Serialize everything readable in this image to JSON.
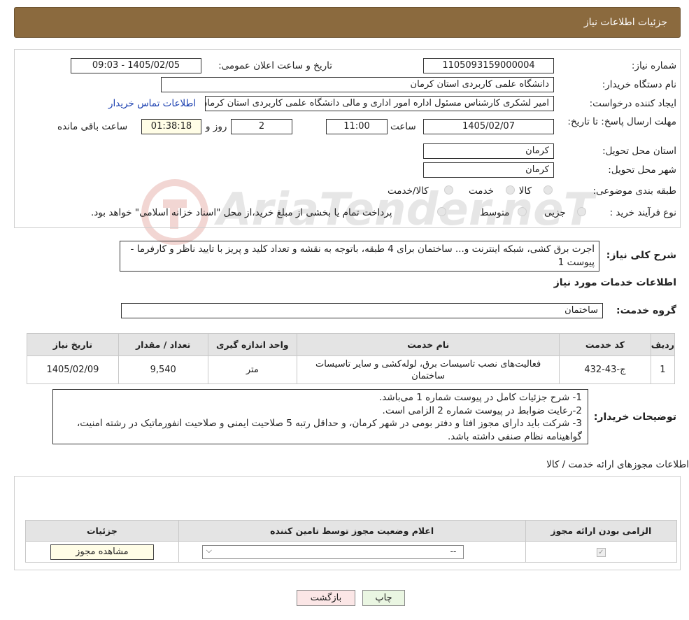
{
  "header": {
    "title": "جزئیات اطلاعات نیاز"
  },
  "form": {
    "need_number_label": "شماره نیاز:",
    "need_number": "1105093159000004",
    "announce_label": "تاریخ و ساعت اعلان عمومی:",
    "announce_value": "1405/02/05 - 09:03",
    "buyer_org_label": "نام دستگاه خریدار:",
    "buyer_org": "دانشگاه علمی کاربردی استان کرمان",
    "creator_label": "ایجاد کننده درخواست:",
    "creator": "امیر لشکری کارشناس مسئول اداره امور اداری و مالی دانشگاه علمی کاربردی استان کرمان",
    "contact_link": "اطلاعات تماس خریدار",
    "deadline_label": "مهلت ارسال پاسخ: تا تاریخ:",
    "deadline_date": "1405/02/07",
    "time_label": "ساعت",
    "deadline_time": "11:00",
    "days": "2",
    "days_label": "روز و",
    "remaining": "01:38:18",
    "remaining_label": "ساعت باقی مانده",
    "province_label": "استان محل تحویل:",
    "province": "کرمان",
    "city_label": "شهر محل تحویل:",
    "city": "کرمان",
    "category_label": "طبقه بندی موضوعی:",
    "category_options": [
      "کالا",
      "خدمت",
      "کالا/خدمت"
    ],
    "process_label": "نوع فرآیند خرید :",
    "process_options": [
      "جزیی",
      "متوسط"
    ],
    "process_note": "پرداخت تمام یا بخشی از مبلغ خرید،از محل \"اسناد خزانه اسلامی\" خواهد بود."
  },
  "summary": {
    "label": "شرح کلی نیاز:",
    "text": "اجرت برق کشی، شبکه اینترنت و... ساختمان برای 4 طبقه، باتوجه به نقشه و تعداد کلید و پریز با تایید ناظر و کارفرما - پیوست 1"
  },
  "services": {
    "section_title": "اطلاعات خدمات مورد نیاز",
    "group_label": "گروه خدمت:",
    "group_value": "ساختمان",
    "headers": [
      "ردیف",
      "کد خدمت",
      "نام خدمت",
      "واحد اندازه گیری",
      "تعداد / مقدار",
      "تاریخ نیاز"
    ],
    "rows": [
      {
        "row": "1",
        "code": "ج-43-432",
        "name": "فعالیت‌های نصب تاسیسات برق، لوله‌کشی و سایر تاسیسات ساختمان",
        "unit": "متر",
        "qty": "9,540",
        "date": "1405/02/09"
      }
    ]
  },
  "buyer_notes": {
    "label": "توضیحات خریدار:",
    "lines": [
      "1- شرح جزئیات کامل در پیوست شماره 1 می‌باشد.",
      "2-رعایت ضوابط در پیوست شماره 2 الزامی است.",
      "3- شرکت باید دارای مجوز افتا و دفتر بومی در شهر کرمان، و حداقل رتبه 5 صلاحیت ایمنی و صلاحیت انفورماتیک در رشته امنیت، گواهینامه نظام صنفی داشته باشد."
    ]
  },
  "licenses": {
    "section_title": "اطلاعات مجوزهای ارائه خدمت / کالا",
    "headers": [
      "الزامی بودن ارائه مجوز",
      "اعلام وضعیت مجوز توسط تامین کننده",
      "جزئیات"
    ],
    "select_value": "--",
    "view_button": "مشاهده مجوز"
  },
  "buttons": {
    "print": "چاپ",
    "back": "بازگشت"
  },
  "watermark": "AriaTender.neT",
  "colors": {
    "header_bg": "#8b6a3e",
    "accent_link": "#1a3fb0"
  }
}
